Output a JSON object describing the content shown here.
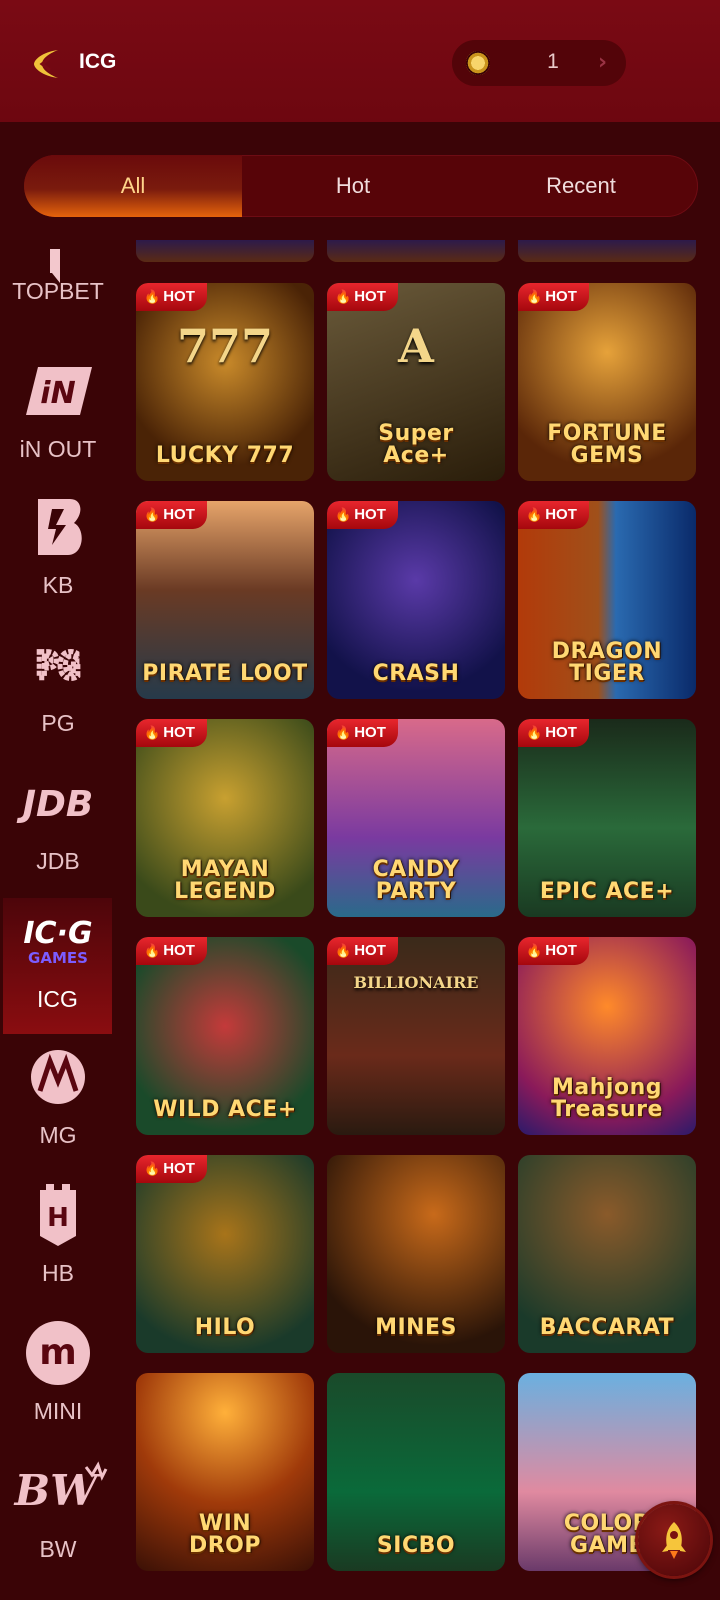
{
  "header": {
    "title": "ICG",
    "balance": "1",
    "icons": {
      "back": "back-arrow-icon",
      "coin": "coin-icon",
      "more": "chevron-right-icon"
    }
  },
  "tabs": [
    {
      "label": "All",
      "active": true
    },
    {
      "label": "Hot"
    },
    {
      "label": "Recent"
    }
  ],
  "providers": [
    {
      "label": "TOPBET",
      "logo_text": ""
    },
    {
      "label": "iN OUT",
      "logo_text": "iN"
    },
    {
      "label": "KB",
      "logo_text": "B"
    },
    {
      "label": "PG",
      "logo_text": "PG"
    },
    {
      "label": "JDB",
      "logo_text": "JDB"
    },
    {
      "label": "ICG",
      "logo_text": "IC·G",
      "logo_sub": "GAMES",
      "active": true
    },
    {
      "label": "MG",
      "logo_text": "M"
    },
    {
      "label": "HB",
      "logo_text": "H"
    },
    {
      "label": "MINI",
      "logo_text": "m"
    },
    {
      "label": "BW",
      "logo_text": "BW"
    }
  ],
  "hot_badge": "HOT",
  "games": [
    {
      "title": "LUCKY 777",
      "hot": true,
      "art_text": "777"
    },
    {
      "title": "Super\nAce+",
      "hot": true,
      "art_text": "A"
    },
    {
      "title": "FORTUNE\nGEMS",
      "hot": true
    },
    {
      "title": "PIRATE LOOT",
      "hot": true
    },
    {
      "title": "CRASH",
      "hot": true
    },
    {
      "title": "DRAGON\nTIGER",
      "hot": true
    },
    {
      "title": "MAYAN\nLEGEND",
      "hot": true
    },
    {
      "title": "CANDY\nPARTY",
      "hot": true
    },
    {
      "title": "EPIC ACE+",
      "hot": true
    },
    {
      "title": "WILD ACE+",
      "hot": true
    },
    {
      "title": "",
      "hot": true,
      "art_text": "BILLIONAIRE"
    },
    {
      "title": "Mahjong\nTreasure",
      "hot": true
    },
    {
      "title": "HILO",
      "hot": true
    },
    {
      "title": "MINES",
      "hot": false
    },
    {
      "title": "BACCARAT",
      "hot": false
    },
    {
      "title": "WIN\nDROP",
      "hot": false
    },
    {
      "title": "SICBO",
      "hot": false
    },
    {
      "title": "COLOR\nGAME",
      "hot": false
    }
  ],
  "colors": {
    "bg": "#3b0407",
    "header": "#7a0a14",
    "accent": "#e6640c",
    "hot": "#d8161f",
    "gold": "#ffd873"
  }
}
